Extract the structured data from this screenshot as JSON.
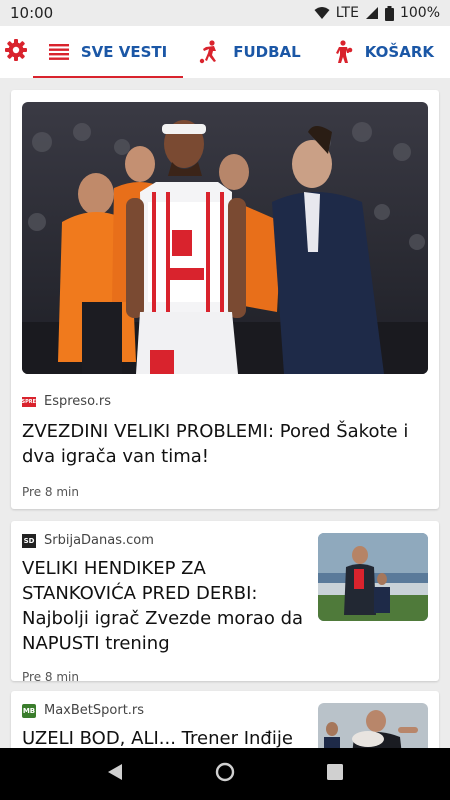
{
  "status_bar": {
    "time": "10:00",
    "network": "LTE",
    "battery": "100%",
    "icons": [
      "wifi-icon",
      "signal-icon",
      "battery-icon"
    ]
  },
  "tabs": [
    {
      "label": "SVE VESTI",
      "icon": "list-icon",
      "active": true
    },
    {
      "label": "FUDBAL",
      "icon": "football-player-icon",
      "active": false
    },
    {
      "label": "KOŠARK",
      "icon": "basketball-player-icon",
      "active": false
    }
  ],
  "colors": {
    "accent_red": "#d9232d",
    "tab_blue": "#1b57a6",
    "background": "#ececec"
  },
  "articles": [
    {
      "source": "Espreso.rs",
      "source_logo": "ESPREX",
      "title": "ZVEZDINI VELIKI PROBLEMI: Pored Šakote i dva igrača van tima!",
      "time": "Pre 8 min",
      "image": "basketball-players-photo"
    },
    {
      "source": "SrbijaDanas.com",
      "source_logo": "SD",
      "title": "VELIKI HENDIKEP ZA STANKOVIĆA PRED DERBI: Najbolji igrač Zvezde morao da NAPUSTI trening",
      "time": "Pre 8 min",
      "image": "football-coach-photo"
    },
    {
      "source": "MaxBetSport.rs",
      "source_logo": "MB",
      "title": "UZELI BOD, ALI... Trener Inđije",
      "image": "coach-on-sideline-photo"
    }
  ],
  "nav_bar": {
    "icons": [
      "back-icon",
      "home-icon",
      "recents-icon"
    ]
  }
}
